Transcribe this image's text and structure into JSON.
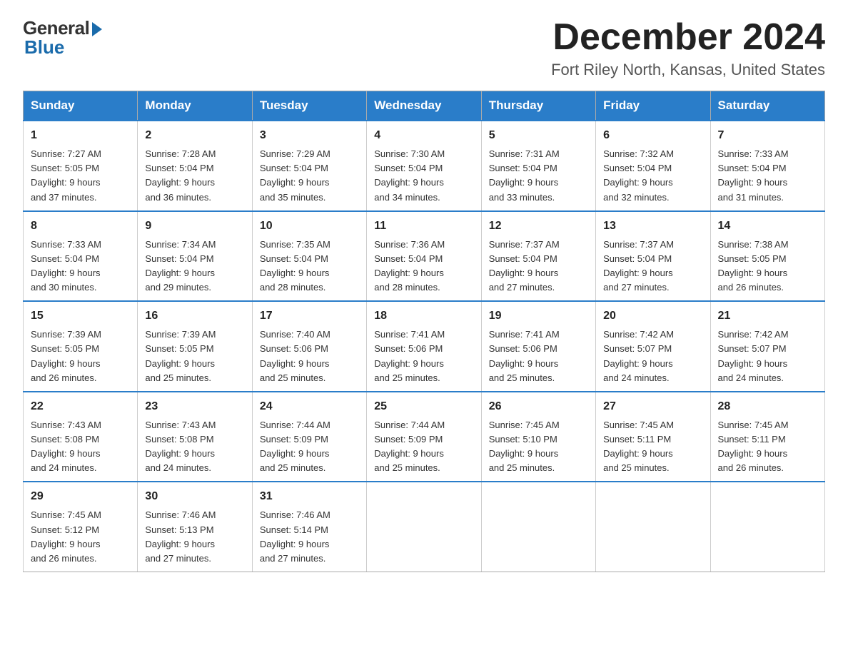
{
  "logo": {
    "general": "General",
    "blue": "Blue"
  },
  "title": "December 2024",
  "location": "Fort Riley North, Kansas, United States",
  "weekdays": [
    "Sunday",
    "Monday",
    "Tuesday",
    "Wednesday",
    "Thursday",
    "Friday",
    "Saturday"
  ],
  "weeks": [
    [
      {
        "day": "1",
        "sunrise": "7:27 AM",
        "sunset": "5:05 PM",
        "daylight": "9 hours and 37 minutes."
      },
      {
        "day": "2",
        "sunrise": "7:28 AM",
        "sunset": "5:04 PM",
        "daylight": "9 hours and 36 minutes."
      },
      {
        "day": "3",
        "sunrise": "7:29 AM",
        "sunset": "5:04 PM",
        "daylight": "9 hours and 35 minutes."
      },
      {
        "day": "4",
        "sunrise": "7:30 AM",
        "sunset": "5:04 PM",
        "daylight": "9 hours and 34 minutes."
      },
      {
        "day": "5",
        "sunrise": "7:31 AM",
        "sunset": "5:04 PM",
        "daylight": "9 hours and 33 minutes."
      },
      {
        "day": "6",
        "sunrise": "7:32 AM",
        "sunset": "5:04 PM",
        "daylight": "9 hours and 32 minutes."
      },
      {
        "day": "7",
        "sunrise": "7:33 AM",
        "sunset": "5:04 PM",
        "daylight": "9 hours and 31 minutes."
      }
    ],
    [
      {
        "day": "8",
        "sunrise": "7:33 AM",
        "sunset": "5:04 PM",
        "daylight": "9 hours and 30 minutes."
      },
      {
        "day": "9",
        "sunrise": "7:34 AM",
        "sunset": "5:04 PM",
        "daylight": "9 hours and 29 minutes."
      },
      {
        "day": "10",
        "sunrise": "7:35 AM",
        "sunset": "5:04 PM",
        "daylight": "9 hours and 28 minutes."
      },
      {
        "day": "11",
        "sunrise": "7:36 AM",
        "sunset": "5:04 PM",
        "daylight": "9 hours and 28 minutes."
      },
      {
        "day": "12",
        "sunrise": "7:37 AM",
        "sunset": "5:04 PM",
        "daylight": "9 hours and 27 minutes."
      },
      {
        "day": "13",
        "sunrise": "7:37 AM",
        "sunset": "5:04 PM",
        "daylight": "9 hours and 27 minutes."
      },
      {
        "day": "14",
        "sunrise": "7:38 AM",
        "sunset": "5:05 PM",
        "daylight": "9 hours and 26 minutes."
      }
    ],
    [
      {
        "day": "15",
        "sunrise": "7:39 AM",
        "sunset": "5:05 PM",
        "daylight": "9 hours and 26 minutes."
      },
      {
        "day": "16",
        "sunrise": "7:39 AM",
        "sunset": "5:05 PM",
        "daylight": "9 hours and 25 minutes."
      },
      {
        "day": "17",
        "sunrise": "7:40 AM",
        "sunset": "5:06 PM",
        "daylight": "9 hours and 25 minutes."
      },
      {
        "day": "18",
        "sunrise": "7:41 AM",
        "sunset": "5:06 PM",
        "daylight": "9 hours and 25 minutes."
      },
      {
        "day": "19",
        "sunrise": "7:41 AM",
        "sunset": "5:06 PM",
        "daylight": "9 hours and 25 minutes."
      },
      {
        "day": "20",
        "sunrise": "7:42 AM",
        "sunset": "5:07 PM",
        "daylight": "9 hours and 24 minutes."
      },
      {
        "day": "21",
        "sunrise": "7:42 AM",
        "sunset": "5:07 PM",
        "daylight": "9 hours and 24 minutes."
      }
    ],
    [
      {
        "day": "22",
        "sunrise": "7:43 AM",
        "sunset": "5:08 PM",
        "daylight": "9 hours and 24 minutes."
      },
      {
        "day": "23",
        "sunrise": "7:43 AM",
        "sunset": "5:08 PM",
        "daylight": "9 hours and 24 minutes."
      },
      {
        "day": "24",
        "sunrise": "7:44 AM",
        "sunset": "5:09 PM",
        "daylight": "9 hours and 25 minutes."
      },
      {
        "day": "25",
        "sunrise": "7:44 AM",
        "sunset": "5:09 PM",
        "daylight": "9 hours and 25 minutes."
      },
      {
        "day": "26",
        "sunrise": "7:45 AM",
        "sunset": "5:10 PM",
        "daylight": "9 hours and 25 minutes."
      },
      {
        "day": "27",
        "sunrise": "7:45 AM",
        "sunset": "5:11 PM",
        "daylight": "9 hours and 25 minutes."
      },
      {
        "day": "28",
        "sunrise": "7:45 AM",
        "sunset": "5:11 PM",
        "daylight": "9 hours and 26 minutes."
      }
    ],
    [
      {
        "day": "29",
        "sunrise": "7:45 AM",
        "sunset": "5:12 PM",
        "daylight": "9 hours and 26 minutes."
      },
      {
        "day": "30",
        "sunrise": "7:46 AM",
        "sunset": "5:13 PM",
        "daylight": "9 hours and 27 minutes."
      },
      {
        "day": "31",
        "sunrise": "7:46 AM",
        "sunset": "5:14 PM",
        "daylight": "9 hours and 27 minutes."
      },
      null,
      null,
      null,
      null
    ]
  ],
  "labels": {
    "sunrise": "Sunrise:",
    "sunset": "Sunset:",
    "daylight": "Daylight:"
  }
}
